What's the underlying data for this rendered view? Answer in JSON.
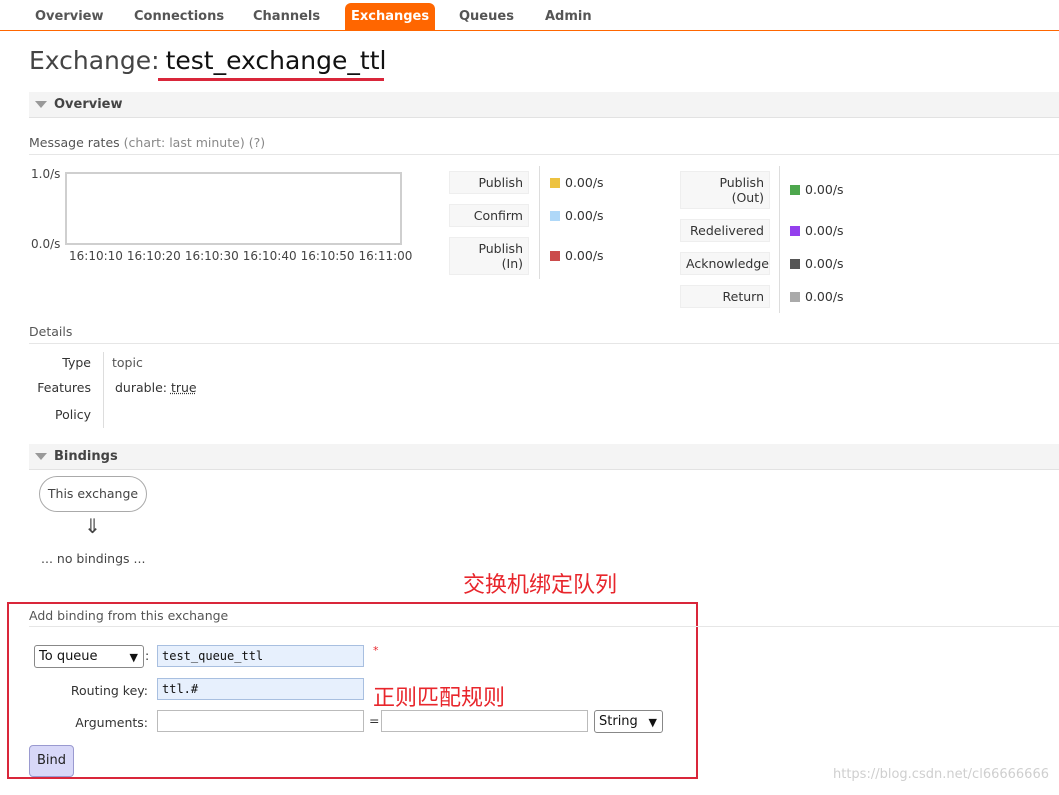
{
  "nav": {
    "tabs": [
      {
        "label": "Overview",
        "active": false
      },
      {
        "label": "Connections",
        "active": false
      },
      {
        "label": "Channels",
        "active": false
      },
      {
        "label": "Exchanges",
        "active": true
      },
      {
        "label": "Queues",
        "active": false
      },
      {
        "label": "Admin",
        "active": false
      }
    ],
    "accent_color": "#ff6600"
  },
  "page": {
    "title_prefix": "Exchange:",
    "exchange_name": "test_exchange_ttl"
  },
  "overview": {
    "header": "Overview",
    "message_rates_label": "Message rates",
    "chart_hint": "(chart: last minute)",
    "help": "(?)",
    "chart": {
      "y_top": "1.0/s",
      "y_bottom": "0.0/s",
      "x_ticks": [
        "16:10:10",
        "16:10:20",
        "16:10:30",
        "16:10:40",
        "16:10:50",
        "16:11:00"
      ]
    },
    "rates_left": [
      {
        "label": "Publish",
        "value": "0.00/s",
        "color": "#edc240"
      },
      {
        "label": "Confirm",
        "value": "0.00/s",
        "color": "#afd8f8"
      },
      {
        "label": "Publish\n(In)",
        "value": "0.00/s",
        "color": "#cb4b4b"
      }
    ],
    "rates_right": [
      {
        "label": "Publish\n(Out)",
        "value": "0.00/s",
        "color": "#4da74d"
      },
      {
        "label": "Redelivered",
        "value": "0.00/s",
        "color": "#9440ed"
      },
      {
        "label": "Acknowledge",
        "value": "0.00/s",
        "color": "#555555"
      },
      {
        "label": "Return",
        "value": "0.00/s",
        "color": "#aaaaaa"
      }
    ]
  },
  "details": {
    "header": "Details",
    "type_label": "Type",
    "type_value": "topic",
    "features_label": "Features",
    "features_key": "durable:",
    "features_value": "true",
    "policy_label": "Policy"
  },
  "bindings": {
    "header": "Bindings",
    "this_exchange": "This exchange",
    "arrow": "⇓",
    "no_bindings": "... no bindings ..."
  },
  "annotations": {
    "bind_queue": "交换机绑定队列",
    "regex_rule": "正则匹配规则"
  },
  "add_binding": {
    "header": "Add binding from this exchange",
    "destination_type": "To queue",
    "destination_value": "test_queue_ttl",
    "required_mark": "*",
    "routing_key_label": "Routing key:",
    "routing_key_value": "ttl.#",
    "arguments_label": "Arguments:",
    "equals": "=",
    "arg_type": "String",
    "bind_label": "Bind",
    "colon": ":"
  },
  "watermark": "https://blog.csdn.net/cl66666666"
}
